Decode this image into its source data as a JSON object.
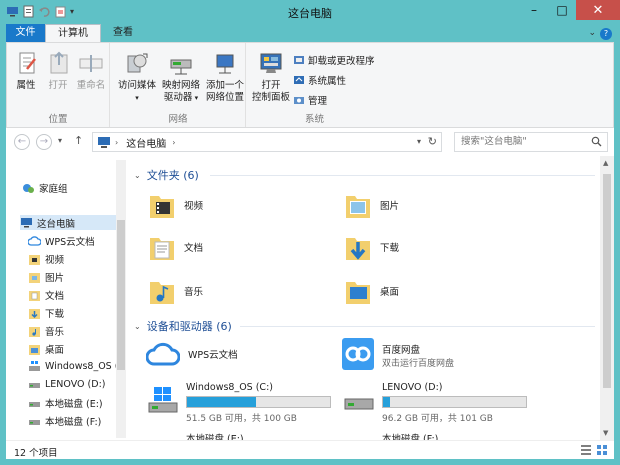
{
  "window": {
    "title": "这台电脑"
  },
  "tabs": {
    "file": "文件",
    "computer": "计算机",
    "view": "查看"
  },
  "ribbon": {
    "location": {
      "label": "位置",
      "properties": "属性",
      "open": "打开",
      "rename": "重命名"
    },
    "network": {
      "label": "网络",
      "access_media": "访问媒体",
      "map_drive_1": "映射网络",
      "map_drive_2": "驱动器",
      "add_location_1": "添加一个",
      "add_location_2": "网络位置"
    },
    "system": {
      "label": "系统",
      "control_panel_1": "打开",
      "control_panel_2": "控制面板",
      "uninstall": "卸载或更改程序",
      "sys_props": "系统属性",
      "manage": "管理"
    }
  },
  "address": {
    "crumb": "这台电脑",
    "search_placeholder": "搜索\"这台电脑\""
  },
  "nav": {
    "homegroup": "家庭组",
    "this_pc": "这台电脑",
    "items": [
      "WPS云文档",
      "视频",
      "图片",
      "文档",
      "下载",
      "音乐",
      "桌面",
      "Windows8_OS (",
      "LENOVO (D:)",
      "本地磁盘 (E:)",
      "本地磁盘 (F:)"
    ]
  },
  "folders": {
    "header": "文件夹 (6)",
    "items": [
      "视频",
      "图片",
      "文档",
      "下载",
      "音乐",
      "桌面"
    ]
  },
  "devices": {
    "header": "设备和驱动器 (6)",
    "wps": "WPS云文档",
    "baidu": "百度网盘",
    "baidu_sub": "双击运行百度网盘",
    "drives": [
      {
        "name": "Windows8_OS (C:)",
        "size": "51.5 GB 可用，共 100 GB",
        "used_fraction": 0.485
      },
      {
        "name": "LENOVO (D:)",
        "size": "96.2 GB 可用，共 101 GB",
        "used_fraction": 0.048
      }
    ],
    "disk_e": "本地磁盘 (E:)",
    "disk_f": "本地磁盘 (F:)"
  },
  "status": {
    "count": "12 个项目"
  }
}
